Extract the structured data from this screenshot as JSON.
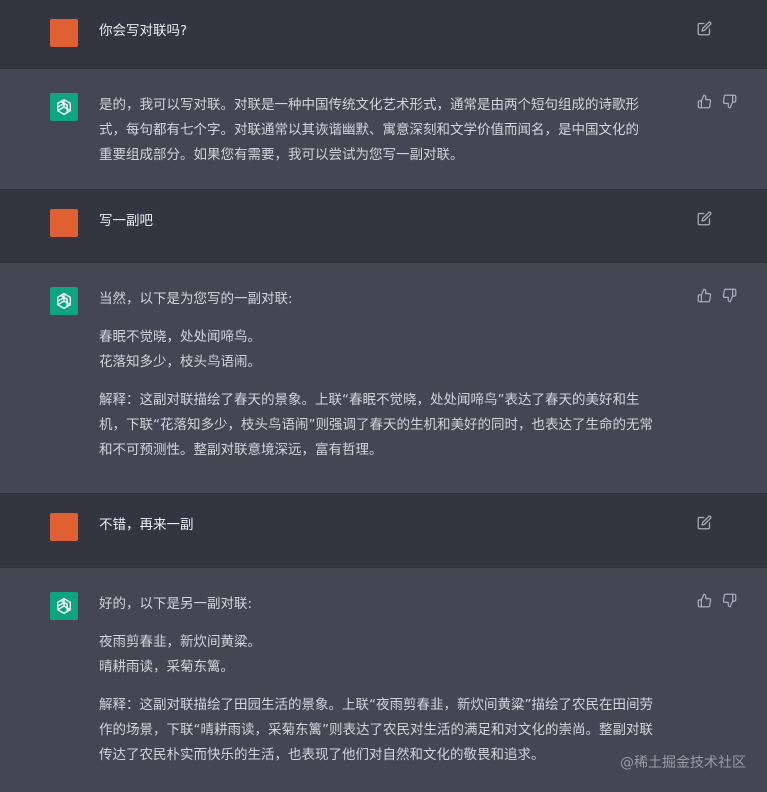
{
  "conversation": [
    {
      "role": "user",
      "lines": [
        "你会写对联吗?"
      ]
    },
    {
      "role": "assistant",
      "lines": [
        "是的，我可以写对联。对联是一种中国传统文化艺术形式，通常是由两个短句组成的诗歌形",
        "式，每句都有七个字。对联通常以其诙谐幽默、寓意深刻和文学价值而闻名，是中国文化的",
        "重要组成部分。如果您有需要，我可以尝试为您写一副对联。"
      ]
    },
    {
      "role": "user",
      "lines": [
        "写一副吧"
      ]
    },
    {
      "role": "assistant",
      "lines": [
        "当然，以下是为您写的一副对联:",
        "",
        "春眠不觉晓，处处闻啼鸟。",
        "花落知多少，枝头鸟语闹。",
        "",
        "解释：这副对联描绘了春天的景象。上联“春眠不觉晓，处处闻啼鸟”表达了春天的美好和生",
        "机，下联“花落知多少，枝头鸟语闹”则强调了春天的生机和美好的同时，也表达了生命的无常",
        "和不可预测性。整副对联意境深远，富有哲理。"
      ]
    },
    {
      "role": "user",
      "lines": [
        "不错，再来一副"
      ]
    },
    {
      "role": "assistant",
      "lines": [
        "好的，以下是另一副对联:",
        "",
        "夜雨剪春韭，新炊间黄粱。",
        "晴耕雨读，采菊东篱。",
        "",
        "解释：这副对联描绘了田园生活的景象。上联“夜雨剪春韭，新炊间黄粱”描绘了农民在田间劳",
        "作的场景，下联“晴耕雨读，采菊东篱”则表达了农民对生活的满足和对文化的崇尚。整副对联",
        "传达了农民朴实而快乐的生活，也表现了他们对自然和文化的敬畏和追求。"
      ]
    }
  ],
  "icons": {
    "edit": "edit-icon",
    "thumbs_up": "thumbs-up-icon",
    "thumbs_down": "thumbs-down-icon",
    "assistant_logo": "openai-logo-icon"
  },
  "colors": {
    "user_bg": "#343541",
    "assistant_bg": "#444654",
    "user_avatar": "#e06034",
    "assistant_avatar": "#10a37f"
  },
  "watermark": "@稀土掘金技术社区"
}
